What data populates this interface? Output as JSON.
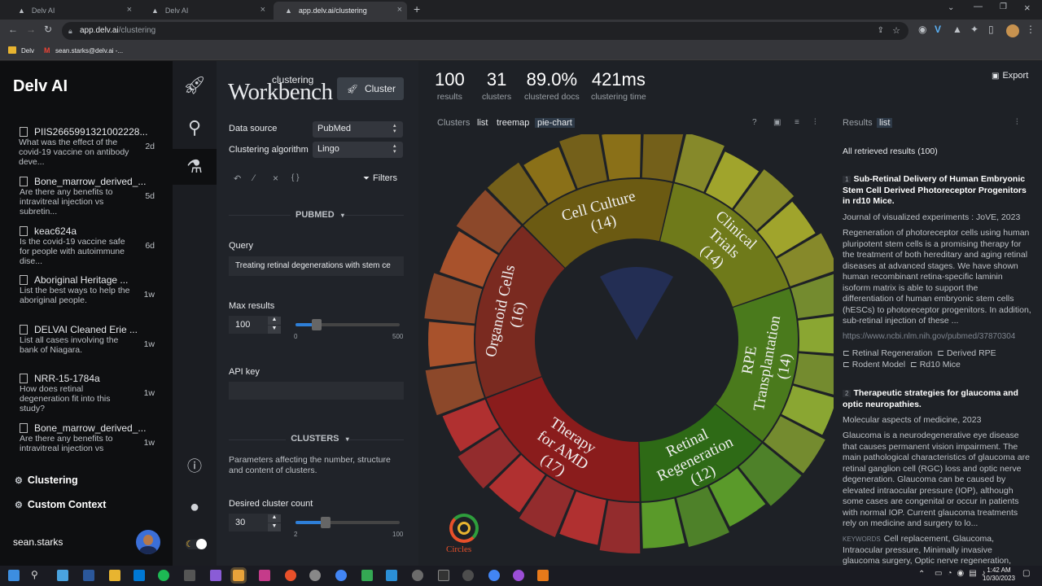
{
  "browser": {
    "tabs": [
      {
        "title": "Delv AI"
      },
      {
        "title": "Delv AI"
      },
      {
        "title": "app.delv.ai/clustering"
      }
    ],
    "url_host": "app.delv.ai",
    "url_path": "/clustering",
    "bookmarks": [
      {
        "label": "Delv"
      },
      {
        "label": "sean.starks@delv.ai -..."
      }
    ]
  },
  "sidebar": {
    "brand": "Delv AI",
    "history": [
      {
        "title": "PIIS2665991321002228...",
        "query": "What was the effect of the covid-19 vaccine on antibody deve...",
        "age": "2d"
      },
      {
        "title": "Bone_marrow_derived_...",
        "query": "Are there any benefits to intravitreal injection vs subretin...",
        "age": "5d"
      },
      {
        "title": "keac624a",
        "query": "Is the covid-19 vaccine safe for people with autoimmune dise...",
        "age": "6d"
      },
      {
        "title": "Aboriginal Heritage ...",
        "query": "List the best ways to help the aboriginal people.",
        "age": "1w"
      },
      {
        "title": "DELVAI Cleaned Erie ...",
        "query": "List all cases involving the bank of Niagara.",
        "age": "1w"
      },
      {
        "title": "NRR-15-1784a",
        "query": "How does retinal degeneration fit into this study?",
        "age": "1w"
      },
      {
        "title": "Bone_marrow_derived_...",
        "query": "Are there any benefits to intravitreal injection vs",
        "age": "1w"
      }
    ],
    "nav": {
      "clustering": "Clustering",
      "custom_context": "Custom Context"
    },
    "user": "sean.starks"
  },
  "panel": {
    "logo_small": "clustering",
    "logo_big": "Workbench",
    "cluster_button": "Cluster",
    "data_source_label": "Data source",
    "data_source_value": "PubMed",
    "algorithm_label": "Clustering algorithm",
    "algorithm_value": "Lingo",
    "filters": "Filters",
    "pubmed_section": "PUBMED",
    "query_label": "Query",
    "query_value": "Treating retinal degenerations with stem ce",
    "max_results_label": "Max results",
    "max_results_value": "100",
    "max_results_min": "0",
    "max_results_max": "500",
    "max_results_level": 0.2,
    "api_key_label": "API key",
    "clusters_section": "CLUSTERS",
    "clusters_desc": "Parameters affecting the number, structure and content of clusters.",
    "desired_count_label": "Desired cluster count",
    "desired_count_value": "30",
    "desired_count_min": "2",
    "desired_count_max": "100",
    "desired_count_level": 0.29
  },
  "stats": [
    {
      "value": "100",
      "label": "results"
    },
    {
      "value": "31",
      "label": "clusters"
    },
    {
      "value": "89.0%",
      "label": "clustered docs"
    },
    {
      "value": "421ms",
      "label": "clustering time"
    }
  ],
  "view_tabs": {
    "clusters": "Clusters",
    "list": "list",
    "treemap": "treemap",
    "pie": "pie-chart"
  },
  "export": "Export",
  "circles_logo": "Circles",
  "chart_data": {
    "type": "pie",
    "inner_ring": [
      {
        "label": "Organoid Cells",
        "count": "(16)",
        "color": "#7a2a20"
      },
      {
        "label": "Cell Culture",
        "count": "(14)",
        "color": "#6b5a12"
      },
      {
        "label": "Clinical Trials",
        "count": "(14)",
        "color": "#6f7a1a"
      },
      {
        "label": "RPE Transplantation",
        "count": "(14)",
        "color": "#4a7a1c"
      },
      {
        "label": "Retinal Regeneration",
        "count": "(12)",
        "color": "#2e6a16"
      },
      {
        "label": "Therapy for AMD",
        "count": "(17)",
        "color": "#8a1c1c"
      }
    ],
    "values": [
      16,
      14,
      14,
      14,
      12,
      17
    ]
  },
  "results": {
    "tab_label": "Results",
    "tab_list": "list",
    "heading": "All retrieved results (100)",
    "items": [
      {
        "num": "1",
        "title": "Sub-Retinal Delivery of Human Embryonic Stem Cell Derived Photoreceptor Progenitors in rd10 Mice.",
        "journal": "Journal of visualized experiments : JoVE, 2023",
        "abstract": "Regeneration of photoreceptor cells using human pluripotent stem cells is a promising therapy for the treatment of both hereditary and aging retinal diseases at advanced stages. We have shown human recombinant retina-specific laminin isoform matrix is able to support the differentiation of human embryonic stem cells (hESCs) to photoreceptor progenitors. In addition, sub-retinal injection of these ...",
        "url": "https://www.ncbi.nlm.nih.gov/pubmed/37870304",
        "tags": [
          "Retinal Regeneration",
          "Derived RPE",
          "Rodent Model",
          "Rd10 Mice"
        ]
      },
      {
        "num": "2",
        "title": "Therapeutic strategies for glaucoma and optic neuropathies.",
        "journal": "Molecular aspects of medicine, 2023",
        "abstract": "Glaucoma is a neurodegenerative eye disease that causes permanent vision impairment. The main pathological characteristics of glaucoma are retinal ganglion cell (RGC) loss and optic nerve degeneration. Glaucoma can be caused by elevated intraocular pressure (IOP), although some cases are congenital or occur in patients with normal IOP. Current glaucoma treatments rely on medicine and surgery to lo...",
        "keywords_label": "KEYWORDS",
        "keywords": "Cell replacement, Glaucoma, Intraocular pressure, Minimally invasive glaucoma surgery, Optic nerve regeneration,"
      }
    ]
  },
  "clock": {
    "time": "1:42 AM",
    "date": "10/30/2023"
  }
}
